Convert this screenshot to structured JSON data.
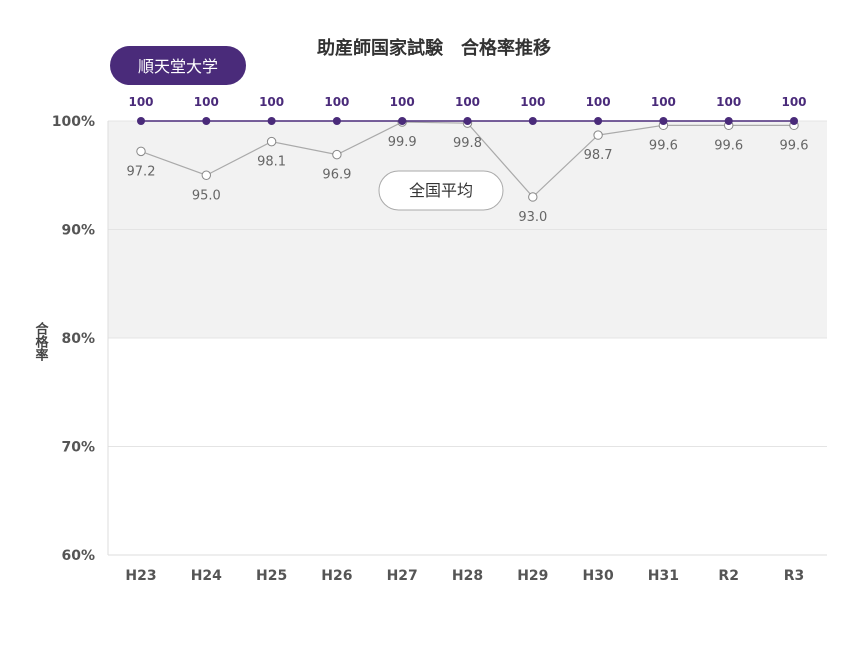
{
  "chart_data": {
    "type": "line",
    "title": "助産師国家試験　合格率推移",
    "ylabel": "合格率",
    "xlabel": "",
    "categories": [
      "H23",
      "H24",
      "H25",
      "H26",
      "H27",
      "H28",
      "H29",
      "H30",
      "H31",
      "R2",
      "R3"
    ],
    "ylim": [
      60,
      100
    ],
    "yticks": [
      "60%",
      "70%",
      "80%",
      "90%",
      "100%"
    ],
    "ytick_values": [
      60,
      70,
      80,
      90,
      100
    ],
    "shaded_band": [
      80,
      100
    ],
    "grid": true,
    "series": [
      {
        "name": "順天堂大学",
        "values": [
          100,
          100,
          100,
          100,
          100,
          100,
          100,
          100,
          100,
          100,
          100
        ],
        "labels": [
          "100",
          "100",
          "100",
          "100",
          "100",
          "100",
          "100",
          "100",
          "100",
          "100",
          "100"
        ],
        "color": "#4a2b7a"
      },
      {
        "name": "全国平均",
        "values": [
          97.2,
          95.0,
          98.1,
          96.9,
          99.9,
          99.8,
          93.0,
          98.7,
          99.6,
          99.6,
          99.6
        ],
        "labels": [
          "97.2",
          "95.0",
          "98.1",
          "96.9",
          "99.9",
          "99.8",
          "93.0",
          "98.7",
          "99.6",
          "99.6",
          "99.6"
        ],
        "color": "#aaaaaa"
      }
    ]
  }
}
